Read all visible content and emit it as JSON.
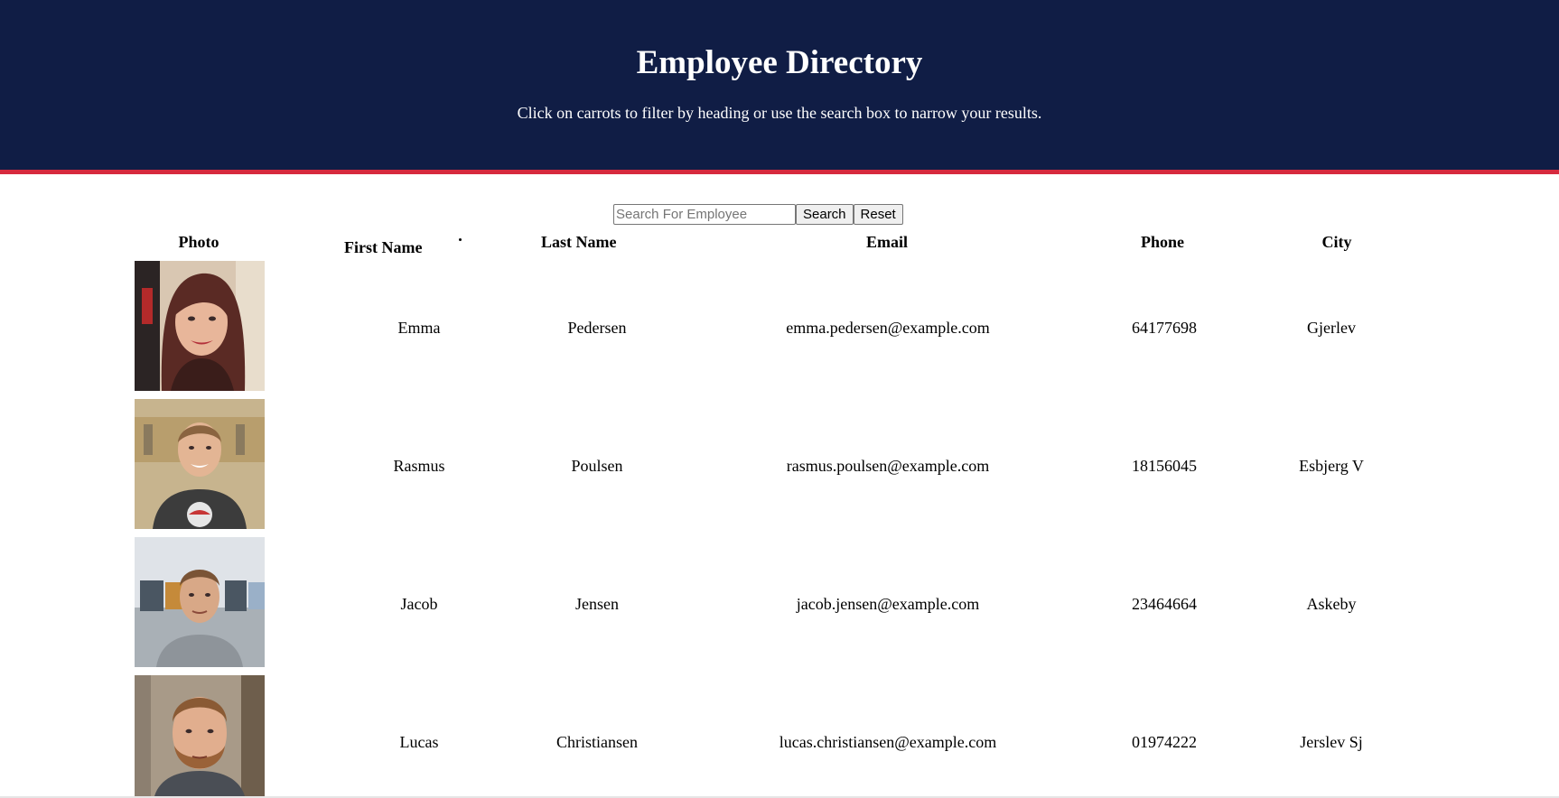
{
  "header": {
    "title": "Employee Directory",
    "subtitle": "Click on carrots to filter by heading or use the search box to narrow your results."
  },
  "search": {
    "placeholder": "Search For Employee",
    "value": "",
    "search_label": "Search",
    "reset_label": "Reset"
  },
  "table": {
    "columns": [
      "Photo",
      "First Name",
      "Last Name",
      "Email",
      "Phone",
      "City"
    ],
    "rows": [
      {
        "first": "Emma",
        "last": "Pedersen",
        "email": "emma.pedersen@example.com",
        "phone": "64177698",
        "city": "Gjerlev"
      },
      {
        "first": "Rasmus",
        "last": "Poulsen",
        "email": "rasmus.poulsen@example.com",
        "phone": "18156045",
        "city": "Esbjerg V"
      },
      {
        "first": "Jacob",
        "last": "Jensen",
        "email": "jacob.jensen@example.com",
        "phone": "23464664",
        "city": "Askeby"
      },
      {
        "first": "Lucas",
        "last": "Christiansen",
        "email": "lucas.christiansen@example.com",
        "phone": "01974222",
        "city": "Jerslev Sj"
      }
    ]
  },
  "colors": {
    "header_bg": "#101d45",
    "header_accent": "#d62a3e"
  }
}
